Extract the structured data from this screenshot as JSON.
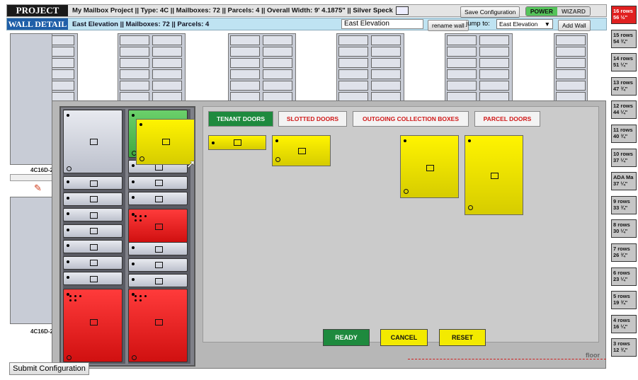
{
  "project": {
    "label": "PROJECT",
    "info": "My Mailbox Project || Type: 4C || Mailboxes: 72 || Parcels: 4 || Overall Width: 9' 4.1875\" || Silver Speck",
    "save": "Save Configuration",
    "power": "POWER",
    "wizard": "WIZARD"
  },
  "wall": {
    "label": "WALL DETAIL",
    "info": "East Elevation || Mailboxes: 72 || Parcels: 4",
    "name_value": "East Elevation",
    "rename": "rename wall",
    "jump_label": "jump to:",
    "jump_value": "East Elevation",
    "add": "Add Wall"
  },
  "bg_labels": [
    "4C16D-2",
    "4C16D-2"
  ],
  "rows": [
    {
      "rows": "16 rows",
      "height": "56 ½\"",
      "active": true
    },
    {
      "rows": "15 rows",
      "height": "54 ¾\""
    },
    {
      "rows": "14 rows",
      "height": "51 ¼\""
    },
    {
      "rows": "13 rows",
      "height": "47 ¾\""
    },
    {
      "rows": "12 rows",
      "height": "44 ¼\""
    },
    {
      "rows": "11 rows",
      "height": "40 ¾\""
    },
    {
      "rows": "10 rows",
      "height": "37 ¼\""
    },
    {
      "rows": "ADA Ma",
      "height": "37 ¼\""
    },
    {
      "rows": "9 rows",
      "height": "33 ¾\""
    },
    {
      "rows": "8 rows",
      "height": "30 ¼\""
    },
    {
      "rows": "7 rows",
      "height": "26 ¾\""
    },
    {
      "rows": "6 rows",
      "height": "23 ¼\""
    },
    {
      "rows": "5 rows",
      "height": "19 ¾\""
    },
    {
      "rows": "4 rows",
      "height": "16 ¼\""
    },
    {
      "rows": "3 rows",
      "height": "12 ¾\""
    }
  ],
  "tabs": {
    "tenant": "TENANT DOORS",
    "slotted": "SLOTTED DOORS",
    "outgoing": "OUTGOING COLLECTION BOXES",
    "parcel": "PARCEL DOORS"
  },
  "actions": {
    "ready": "READY",
    "cancel": "CANCEL",
    "reset": "RESET"
  },
  "floor": "floor",
  "submit": "Submit Configuration",
  "colors": {
    "green": "#1e8a3e",
    "red": "#d01818",
    "yellow": "#f3ea00",
    "blue": "#1f5fa8"
  }
}
